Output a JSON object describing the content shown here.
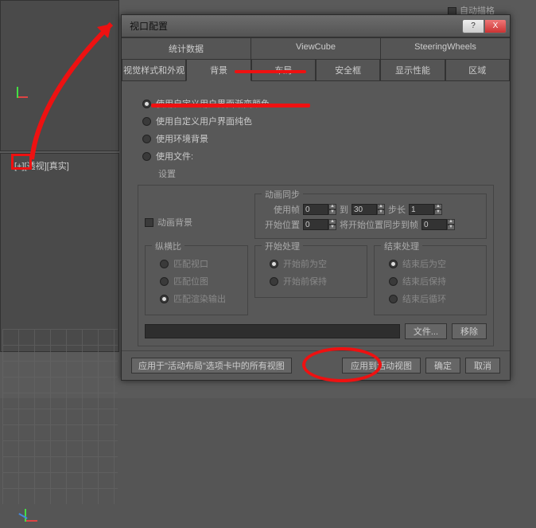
{
  "bg": {
    "viewport_label": "[+][透视][真实]",
    "auto_check": "自动描格"
  },
  "dialog": {
    "title": "视口配置",
    "winbtns": {
      "help": "?",
      "close": "X"
    },
    "tabs_top": [
      "统计数据",
      "ViewCube",
      "SteeringWheels"
    ],
    "tabs_bottom": [
      "视觉样式和外观",
      "背景",
      "布局",
      "安全框",
      "显示性能",
      "区域"
    ],
    "active_tab": "背景",
    "radios": {
      "gradient": "使用自定义用户界面渐变颜色",
      "solid": "使用自定义用户界面纯色",
      "env": "使用环境背景",
      "file": "使用文件:"
    },
    "settings_label": "设置",
    "anim_bg": "动画背景",
    "sync": {
      "title": "动画同步",
      "use_frame": "使用帧",
      "to": "到",
      "step": "步长",
      "start_pos": "开始位置",
      "sync_start": "将开始位置同步到帧",
      "use_frame_val": "0",
      "to_val": "30",
      "step_val": "1",
      "start_pos_val": "0",
      "sync_start_val": "0"
    },
    "aspect": {
      "title": "纵横比",
      "match_viewport": "匹配视口",
      "match_bitmap": "匹配位图",
      "match_render": "匹配渲染输出"
    },
    "start_proc": {
      "title": "开始处理",
      "blank_before": "开始前为空",
      "hold_before": "开始前保持"
    },
    "end_proc": {
      "title": "结束处理",
      "blank_after": "结束后为空",
      "hold_after": "结束后保持",
      "loop_after": "结束后循环"
    },
    "file_btn": "文件...",
    "remove_btn": "移除",
    "footer": {
      "apply_all": "应用于\"活动布局\"选项卡中的所有视图",
      "apply_active": "应用到活动视图",
      "ok": "确定",
      "cancel": "取消"
    }
  }
}
